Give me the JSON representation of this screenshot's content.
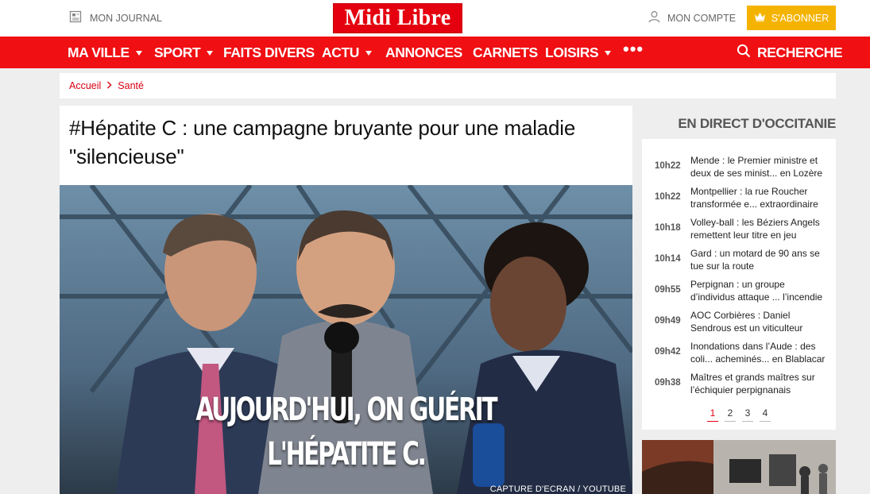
{
  "header": {
    "journal_label": "MON JOURNAL",
    "logo_text": "Midi Libre",
    "account_label": "MON COMPTE",
    "subscribe_label": "S'ABONNER"
  },
  "nav": {
    "items": [
      {
        "label": "MA VILLE",
        "dropdown": true
      },
      {
        "label": "SPORT",
        "dropdown": true
      },
      {
        "label": "FAITS DIVERS",
        "dropdown": false
      },
      {
        "label": "ACTU",
        "dropdown": true
      },
      {
        "label": "ANNONCES",
        "dropdown": false
      },
      {
        "label": "CARNETS",
        "dropdown": false
      },
      {
        "label": "LOISIRS",
        "dropdown": true
      }
    ],
    "more_label": "•••",
    "search_label": "RECHERCHE"
  },
  "breadcrumb": {
    "home": "Accueil",
    "section": "Santé"
  },
  "article": {
    "title": "#Hépatite C : une campagne bruyante pour une maladie \"silencieuse\"",
    "image_caption_line1": "AUJOURD'HUI, ON GUÉRIT",
    "image_caption_line2": "L'HÉPATITE C.",
    "image_credit": "CAPTURE D'ECRAN / YOUTUBE"
  },
  "sidebar": {
    "heading": "EN DIRECT D'OCCITANIE",
    "items": [
      {
        "time": "10h22",
        "text": "Mende : le Premier ministre et deux de ses minist... en Lozère"
      },
      {
        "time": "10h22",
        "text": "Montpellier : la rue Roucher transformée e... extraordinaire"
      },
      {
        "time": "10h18",
        "text": "Volley-ball : les Béziers Angels remettent leur titre en jeu"
      },
      {
        "time": "10h14",
        "text": "Gard : un motard de 90 ans se tue sur la route"
      },
      {
        "time": "09h55",
        "text": "Perpignan : un groupe d’individus attaque ... l’incendie"
      },
      {
        "time": "09h49",
        "text": "AOC Corbières : Daniel Sendrous est un viticulteur"
      },
      {
        "time": "09h42",
        "text": "Inondations dans l’Aude : des coli... acheminés... en Blablacar"
      },
      {
        "time": "09h38",
        "text": "Maîtres et grands maîtres sur l’échiquier perpignanais"
      }
    ],
    "pages": [
      "1",
      "2",
      "3",
      "4"
    ],
    "active_page": "1"
  },
  "colors": {
    "brand_red": "#f00f13",
    "subscribe_yellow": "#f5b301"
  },
  "icons": {
    "journal": "newspaper-icon",
    "account": "user-icon",
    "subscribe": "crown-icon",
    "search": "search-icon"
  }
}
